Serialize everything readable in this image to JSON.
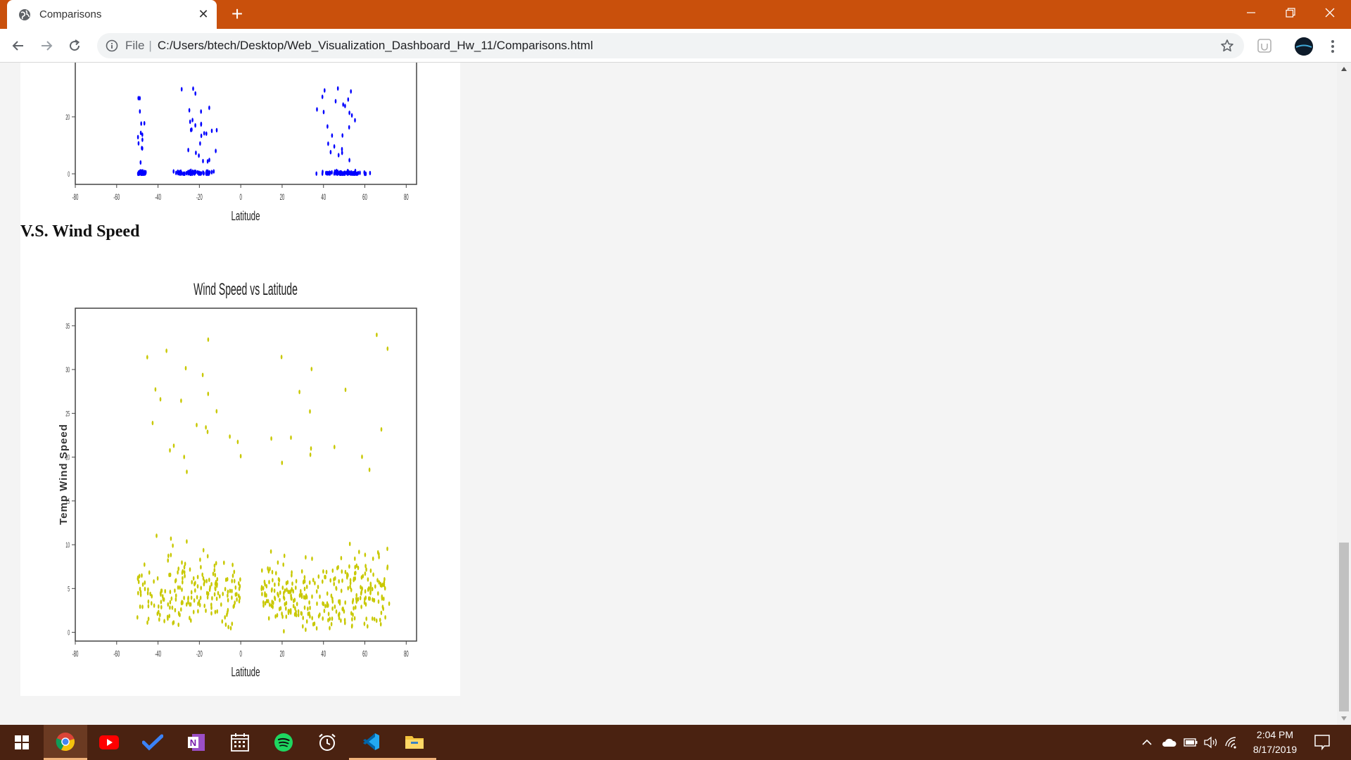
{
  "browser": {
    "tab_title": "Comparisons",
    "address_prefix": "File",
    "url": "C:/Users/btech/Desktop/Web_Visualization_Dashboard_Hw_11/Comparisons.html"
  },
  "page": {
    "section_heading": "V.S. Wind Speed"
  },
  "chart_data": [
    {
      "type": "scatter",
      "title": "",
      "xlabel": "Latitude",
      "ylabel": "",
      "xlim": [
        -80,
        85
      ],
      "x_ticks": [
        "-80",
        "-60",
        "-40",
        "-20",
        "0",
        "20",
        "40",
        "60",
        "80"
      ],
      "y_ticks": [
        "0",
        "20"
      ],
      "color": "#0000ff",
      "grid": false,
      "points_seed": 11
    },
    {
      "type": "scatter",
      "title": "Wind Speed vs Latitude",
      "xlabel": "Latitude",
      "ylabel": "Temp Wind Speed",
      "xlim": [
        -80,
        85
      ],
      "ylim": [
        -1,
        37
      ],
      "x_ticks": [
        "-80",
        "-60",
        "-40",
        "-20",
        "0",
        "20",
        "40",
        "60",
        "80"
      ],
      "y_ticks": [
        "0",
        "5",
        "10",
        "15",
        "20",
        "25",
        "30",
        "35"
      ],
      "color": "#c8c800",
      "grid": false,
      "points_seed": 7
    }
  ],
  "taskbar": {
    "time": "2:04 PM",
    "date": "8/17/2019",
    "apps": [
      "start",
      "chrome",
      "youtube",
      "todo",
      "onenote",
      "calendar",
      "spotify",
      "clock",
      "vscode",
      "file-explorer"
    ]
  },
  "colors": {
    "titlebar": "#c9500c",
    "taskbar": "#4a2211",
    "scatter_blue": "#0000ff",
    "scatter_yellow": "#c8c800"
  }
}
